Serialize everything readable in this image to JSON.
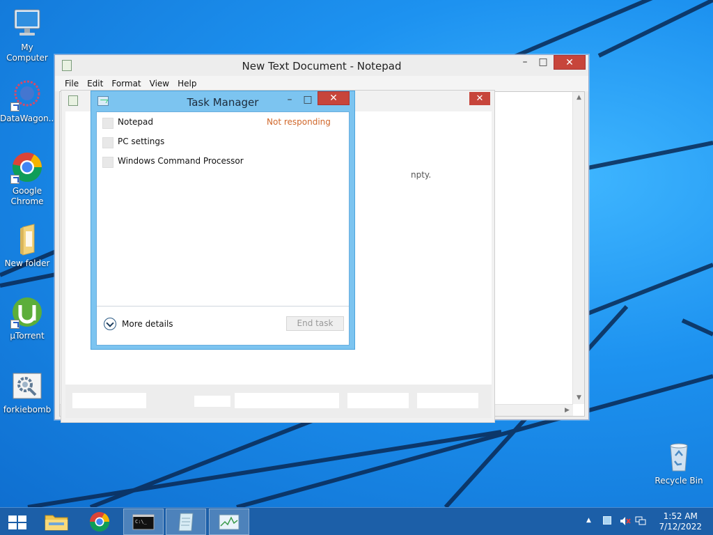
{
  "desktop": {
    "icons": [
      {
        "label": "My Computer",
        "icon": "computer-icon"
      },
      {
        "label": "DataWagon...",
        "icon": "datawagon-icon"
      },
      {
        "label": "Google Chrome",
        "icon": "chrome-icon"
      },
      {
        "label": "New folder",
        "icon": "folder-icon"
      },
      {
        "label": "µTorrent",
        "icon": "utorrent-icon"
      },
      {
        "label": "forkiebomb",
        "icon": "settings-script-icon"
      },
      {
        "label": "Recycle Bin",
        "icon": "recycle-bin-icon"
      }
    ]
  },
  "notepad": {
    "title": "New Text Document - Notepad",
    "menu": [
      "File",
      "Edit",
      "Format",
      "View",
      "Help"
    ],
    "close_glyph": "✕",
    "min_glyph": "–",
    "max_glyph": "□"
  },
  "ghost_window": {
    "partial_text": "npty."
  },
  "task_manager": {
    "title": "Task Manager",
    "processes": [
      {
        "name": "Notepad",
        "status": "Not responding"
      },
      {
        "name": "PC settings",
        "status": ""
      },
      {
        "name": "Windows Command Processor",
        "status": ""
      }
    ],
    "more_details": "More details",
    "end_task": "End task",
    "status_color": "#d0672a"
  },
  "taskbar": {
    "items": [
      "start-button",
      "file-explorer",
      "chrome",
      "command-prompt",
      "notepad",
      "task-manager"
    ],
    "active": "task-manager",
    "clock_time": "1:52 AM",
    "clock_date": "7/12/2022"
  },
  "colors": {
    "accent": "#4da3dc",
    "close_red": "#c7453b",
    "taskbar": "#1c5fa8"
  }
}
